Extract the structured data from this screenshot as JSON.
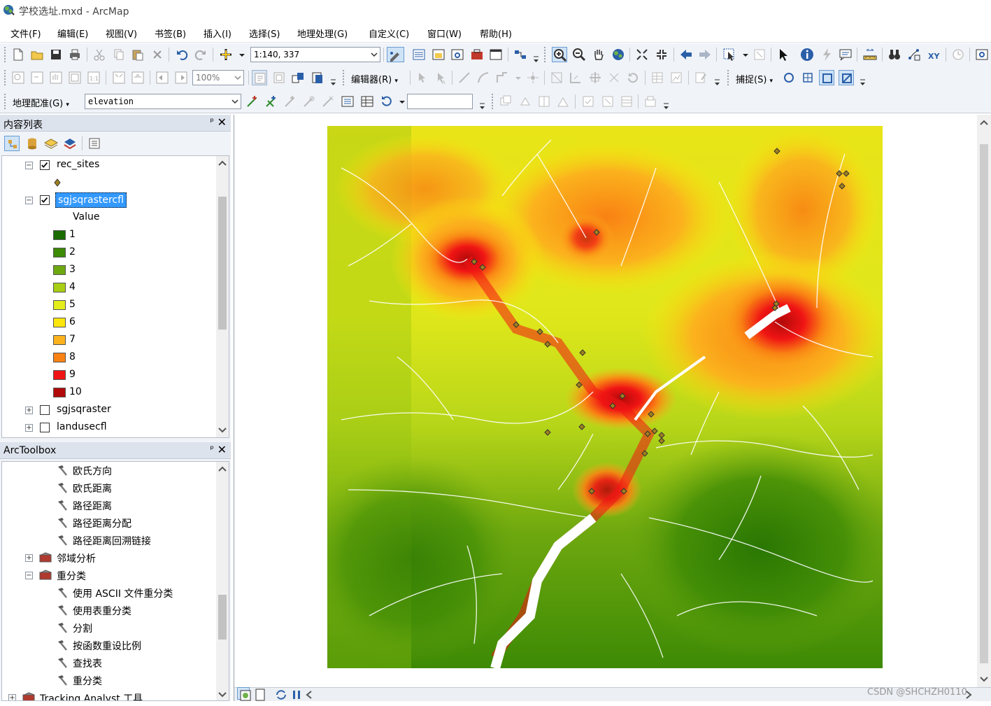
{
  "window": {
    "title": "学校选址.mxd - ArcMap"
  },
  "menu": [
    "文件(F)",
    "编辑(E)",
    "视图(V)",
    "书签(B)",
    "插入(I)",
    "选择(S)",
    "地理处理(G)",
    "自定义(C)",
    "窗口(W)",
    "帮助(H)"
  ],
  "toolbar": {
    "scale_value": "1:140, 337",
    "zoom_percent": "100%",
    "editor_label": "编辑器(R)",
    "snapping_label": "捕捉(S)",
    "georef_label": "地理配准(G)",
    "georef_layer": "elevation",
    "georef_input": ""
  },
  "toc": {
    "title": "内容列表",
    "pin": "ᵖ",
    "close": "✕",
    "layers": [
      {
        "name": "rec_sites",
        "checked": true
      },
      {
        "name": "sgjsqrastercfl",
        "checked": true
      },
      {
        "name": "sgjsqraster",
        "checked": false
      },
      {
        "name": "landusecfl",
        "checked": false
      }
    ],
    "legend_heading": "Value",
    "legend": [
      {
        "label": "1",
        "color": "#1a6b00"
      },
      {
        "label": "2",
        "color": "#3d8a05"
      },
      {
        "label": "3",
        "color": "#6ea80f"
      },
      {
        "label": "4",
        "color": "#a8cf14"
      },
      {
        "label": "5",
        "color": "#e3ee1a"
      },
      {
        "label": "6",
        "color": "#fde60c"
      },
      {
        "label": "7",
        "color": "#fbb21d"
      },
      {
        "label": "8",
        "color": "#f98213"
      },
      {
        "label": "9",
        "color": "#f01414"
      },
      {
        "label": "10",
        "color": "#b20a0a"
      }
    ],
    "point_symbol_color": "#a0801e"
  },
  "toolbox": {
    "title": "ArcToolbox",
    "items": [
      {
        "label": "欧氏方向",
        "kind": "tool"
      },
      {
        "label": "欧氏距离",
        "kind": "tool"
      },
      {
        "label": "路径距离",
        "kind": "tool"
      },
      {
        "label": "路径距离分配",
        "kind": "tool"
      },
      {
        "label": "路径距离回溯链接",
        "kind": "tool"
      },
      {
        "label": "邻域分析",
        "kind": "toolset-collapsed"
      },
      {
        "label": "重分类",
        "kind": "toolset-expanded"
      },
      {
        "label": "使用 ASCII 文件重分类",
        "kind": "tool"
      },
      {
        "label": "使用表重分类",
        "kind": "tool"
      },
      {
        "label": "分割",
        "kind": "tool"
      },
      {
        "label": "按函数重设比例",
        "kind": "tool"
      },
      {
        "label": "查找表",
        "kind": "tool"
      },
      {
        "label": "重分类",
        "kind": "tool"
      },
      {
        "label": "Tracking Analyst 工具",
        "kind": "toolbox-collapsed"
      }
    ]
  },
  "watermark": "CSDN @SHCHZH0110"
}
